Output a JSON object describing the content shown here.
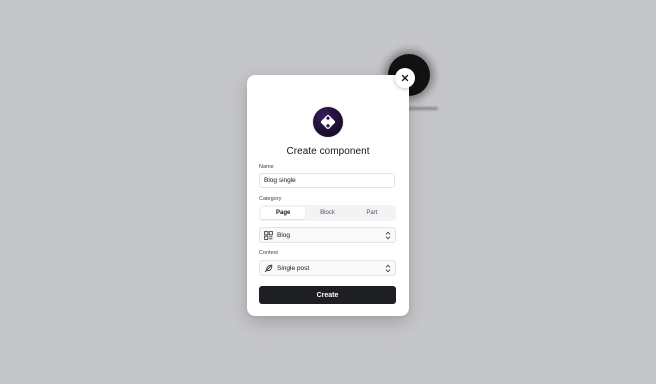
{
  "close_label": "×",
  "dialog": {
    "title": "Create component",
    "name_label": "Name",
    "name_value": "Blog single",
    "category_label": "Category",
    "category_tabs": [
      "Page",
      "Block",
      "Part"
    ],
    "category_selected": "Page",
    "type_select_value": "Blog",
    "context_label": "Context",
    "context_select_value": "Single post",
    "submit_label": "Create"
  },
  "icons": {
    "close": "close-icon",
    "logo": "diamond-grid-logo-icon",
    "type": "grid-layout-icon",
    "context": "feather-icon",
    "chevron": "chevron-up-down-icon"
  },
  "colors": {
    "backdrop": "#c5c6c9",
    "primary_button": "#1e1f22",
    "logo_bg": "#20123a"
  }
}
